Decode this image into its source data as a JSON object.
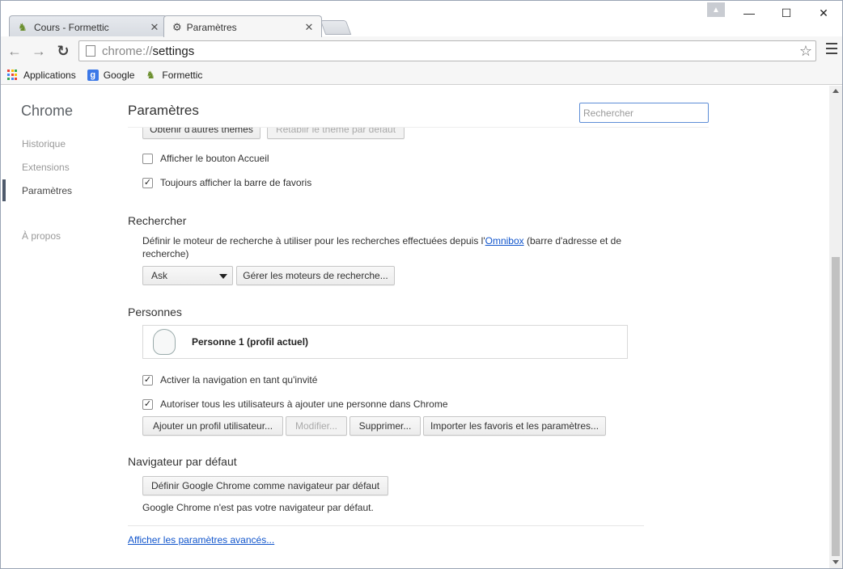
{
  "tabs": [
    {
      "title": "Cours - Formettic",
      "icon": "formettic-icon",
      "active": false
    },
    {
      "title": "Paramètres",
      "icon": "gear-icon",
      "active": true
    }
  ],
  "toolbar": {
    "url_scheme": "chrome://",
    "url_path": "settings"
  },
  "bookmarks": [
    {
      "label": "Applications",
      "icon": "apps-grid-icon"
    },
    {
      "label": "Google",
      "icon": "google-icon"
    },
    {
      "label": "Formettic",
      "icon": "formettic-icon"
    }
  ],
  "sidebar": {
    "brand": "Chrome",
    "items": [
      "Historique",
      "Extensions",
      "Paramètres",
      "À propos"
    ],
    "active": "Paramètres"
  },
  "header": {
    "title": "Paramètres",
    "search_placeholder": "Rechercher"
  },
  "appearance": {
    "btn_themes": "Obtenir d'autres thèmes",
    "btn_reset_theme": "Rétablir le thème par défaut",
    "show_home": {
      "label": "Afficher le bouton Accueil",
      "checked": false
    },
    "show_bookmarks": {
      "label": "Toujours afficher la barre de favoris",
      "checked": true
    }
  },
  "search": {
    "title": "Rechercher",
    "desc_before": "Définir le moteur de recherche à utiliser pour les recherches effectuées depuis l'",
    "desc_link": "Omnibox",
    "desc_after_1": " (barre d'adresse et de",
    "desc_after_2": "recherche)",
    "engine_selected": "Ask",
    "btn_manage": "Gérer les moteurs de recherche..."
  },
  "people": {
    "title": "Personnes",
    "profile_name": "Personne 1 (profil actuel)",
    "guest": {
      "label": "Activer la navigation en tant qu'invité",
      "checked": true
    },
    "add_person": {
      "label": "Autoriser tous les utilisateurs à ajouter une personne dans Chrome",
      "checked": true
    },
    "btn_add": "Ajouter un profil utilisateur...",
    "btn_edit": "Modifier...",
    "btn_delete": "Supprimer...",
    "btn_import": "Importer les favoris et les paramètres..."
  },
  "default_browser": {
    "title": "Navigateur par défaut",
    "btn_set_default": "Définir Google Chrome comme navigateur par défaut",
    "status": "Google Chrome n'est pas votre navigateur par défaut."
  },
  "advanced_link": "Afficher les paramètres avancés...",
  "colors": {
    "link": "#1155cc",
    "search_focus": "#5d8dd6",
    "sidebar_marker": "#4e5a6b"
  }
}
